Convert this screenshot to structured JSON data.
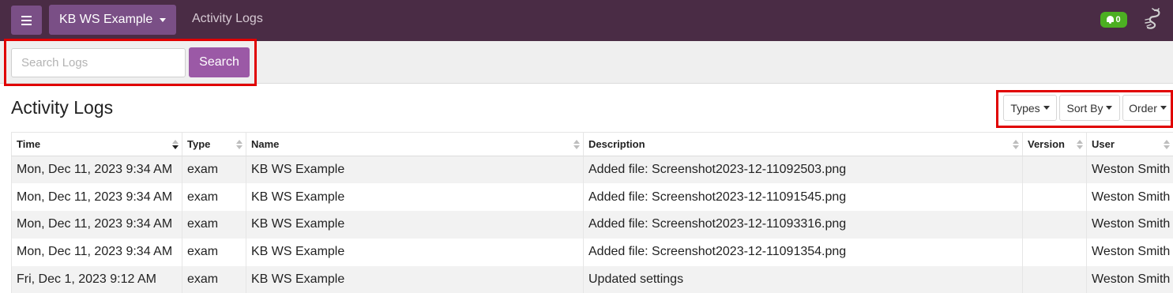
{
  "navbar": {
    "workspace_label": "KB WS Example",
    "breadcrumb": "Activity Logs",
    "notification_count": "0"
  },
  "search": {
    "placeholder": "Search Logs",
    "value": "",
    "button_label": "Search"
  },
  "page": {
    "title": "Activity Logs"
  },
  "filters": {
    "types_label": "Types",
    "sort_by_label": "Sort By",
    "order_label": "Order"
  },
  "table": {
    "columns": [
      "Time",
      "Type",
      "Name",
      "Description",
      "Version",
      "User"
    ],
    "sorted_column": "Time",
    "rows": [
      [
        "Mon, Dec 11, 2023 9:34 AM",
        "exam",
        "KB WS Example",
        "Added file: Screenshot2023-12-11092503.png",
        "",
        "Weston Smith"
      ],
      [
        "Mon, Dec 11, 2023 9:34 AM",
        "exam",
        "KB WS Example",
        "Added file: Screenshot2023-12-11091545.png",
        "",
        "Weston Smith"
      ],
      [
        "Mon, Dec 11, 2023 9:34 AM",
        "exam",
        "KB WS Example",
        "Added file: Screenshot2023-12-11093316.png",
        "",
        "Weston Smith"
      ],
      [
        "Mon, Dec 11, 2023 9:34 AM",
        "exam",
        "KB WS Example",
        "Added file: Screenshot2023-12-11091354.png",
        "",
        "Weston Smith"
      ],
      [
        "Fri, Dec 1, 2023 9:12 AM",
        "exam",
        "KB WS Example",
        "Updated settings",
        "",
        "Weston Smith"
      ]
    ]
  },
  "colors": {
    "navbar_bg": "#4a2c45",
    "nav_button_bg": "#7a4f86",
    "search_button_bg": "#9b59a6",
    "notification_badge": "#4caf22",
    "highlight_box": "#e00000"
  },
  "icons": {
    "menu": "hamburger-menu-icon",
    "dropdown": "chevron-down-icon",
    "notifications": "bell-icon",
    "logo": "scorpion-logo-icon",
    "sort": "sort-icon"
  }
}
